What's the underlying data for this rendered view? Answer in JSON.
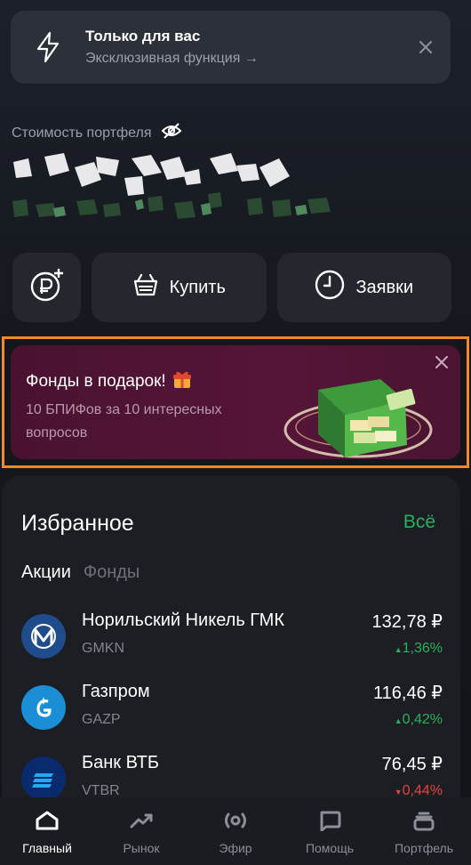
{
  "promo": {
    "title": "Только для вас",
    "subtitle": "Эксклюзивная функция →"
  },
  "portfolio": {
    "label": "Стоимость портфеля"
  },
  "actions": {
    "buy_label": "Купить",
    "orders_label": "Заявки"
  },
  "banner": {
    "title": "Фонды в подарок!",
    "subtitle": "10 БПИФов за 10 интересных вопросов"
  },
  "favorites": {
    "title": "Избранное",
    "all_label": "Всё",
    "tabs": [
      "Акции",
      "Фонды"
    ],
    "stocks": [
      {
        "name": "Норильский Никель ГМК",
        "ticker": "GMKN",
        "price": "132,78 ₽",
        "change": "1,36%",
        "direction": "up"
      },
      {
        "name": "Газпром",
        "ticker": "GAZP",
        "price": "116,46 ₽",
        "change": "0,42%",
        "direction": "up"
      },
      {
        "name": "Банк ВТБ",
        "ticker": "VTBR",
        "price": "76,45 ₽",
        "change": "0,44%",
        "direction": "down"
      }
    ]
  },
  "tabbar": {
    "items": [
      "Главный",
      "Рынок",
      "Эфир",
      "Помощь",
      "Портфель"
    ]
  },
  "colors": {
    "accent_green": "#27b35a",
    "down_red": "#e5443a",
    "banner_bg": "#551538",
    "highlight_border": "#f08a2a"
  }
}
